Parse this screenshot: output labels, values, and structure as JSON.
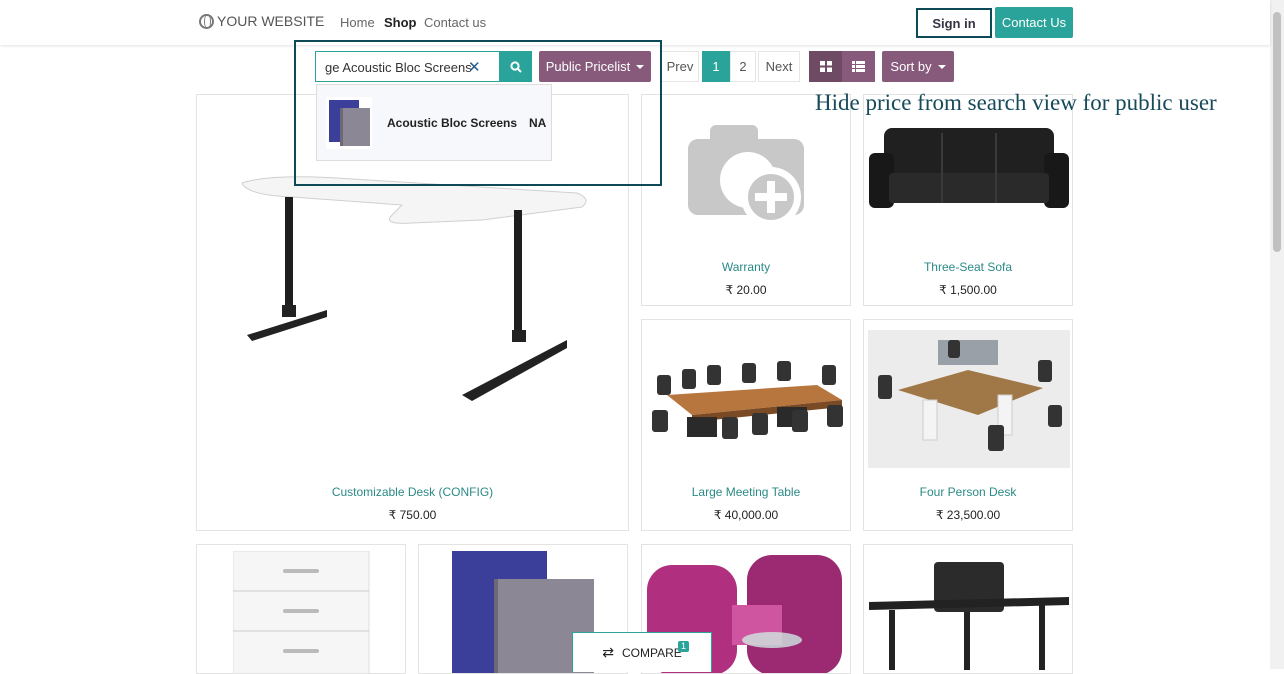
{
  "header": {
    "logo_text": "YOUR WEBSITE",
    "nav": [
      "Home",
      "Shop",
      "Contact us"
    ],
    "active_nav": "Shop",
    "sign_in": "Sign in",
    "contact_us": "Contact Us"
  },
  "toolbar": {
    "search_value": "ge Acoustic Bloc Screens",
    "pricelist": "Public Pricelist",
    "pager_prev": "Prev",
    "pager_pages": [
      "1",
      "2"
    ],
    "pager_next": "Next",
    "sort_by": "Sort by"
  },
  "search_dropdown": {
    "product_name": "Acoustic Bloc Screens",
    "price_text": "NA"
  },
  "annotation": "Hide price from search view for public user",
  "products": [
    {
      "name": "Customizable Desk (CONFIG)",
      "price": "₹ 750.00"
    },
    {
      "name": "Warranty",
      "price": "₹ 20.00"
    },
    {
      "name": "Three-Seat Sofa",
      "price": "₹ 1,500.00"
    },
    {
      "name": "Large Meeting Table",
      "price": "₹ 40,000.00"
    },
    {
      "name": "Four Person Desk",
      "price": "₹ 23,500.00"
    }
  ],
  "compare": {
    "label": "COMPARE",
    "count": "1"
  },
  "colors": {
    "primary": "#2aa39a",
    "secondary": "#875a7b",
    "highlight": "#0d4a58"
  }
}
